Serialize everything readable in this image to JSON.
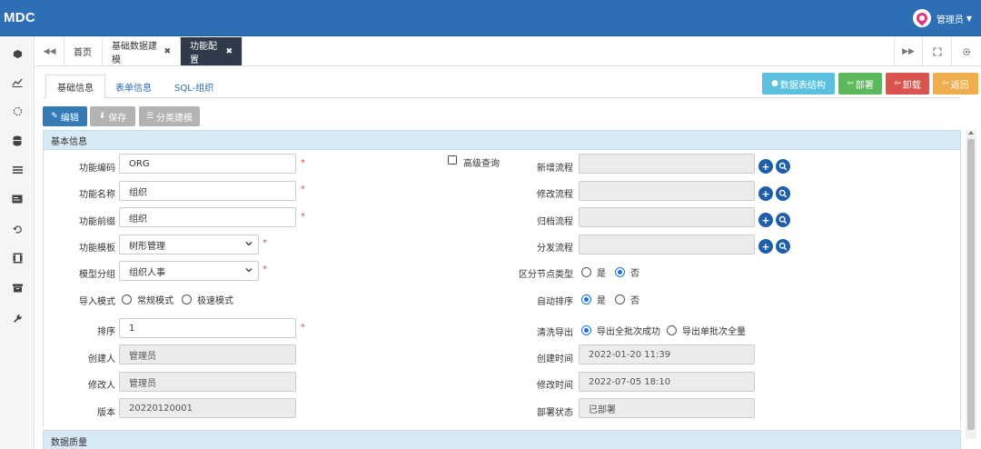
{
  "app": {
    "brand": "MDC",
    "user_name": "管理员"
  },
  "sidebar": {
    "icons": [
      "cube-icon",
      "chart-line-icon",
      "spinner-icon",
      "database-icon",
      "list-icon",
      "card-icon",
      "history-icon",
      "film-icon",
      "archive-icon",
      "wrench-icon"
    ]
  },
  "tabstrip": {
    "tabs": [
      {
        "label": "首页",
        "closable": false
      },
      {
        "label": "基础数据建模",
        "closable": true
      },
      {
        "label": "功能配置",
        "closable": true
      }
    ],
    "close_glyph": "✖"
  },
  "inner_tabs": [
    "基础信息",
    "表单信息",
    "SQL-组织"
  ],
  "right_buttons": {
    "structure": "数据表结构",
    "deploy": "部署",
    "undeploy": "卸载",
    "back": "返回",
    "colors": {
      "structure": "#5bc0de",
      "deploy": "#5cb85c",
      "undeploy": "#d9534f",
      "back": "#f0ad4e"
    }
  },
  "actions": {
    "edit": "编辑",
    "save": "保存",
    "category": "分类建模"
  },
  "panel": {
    "title": "基本信息",
    "next_title": "数据质量"
  },
  "form": {
    "func_code": {
      "label": "功能编码",
      "value": "ORG"
    },
    "func_name": {
      "label": "功能名称",
      "value": "组织"
    },
    "func_prefix": {
      "label": "功能前缀",
      "value": "组织"
    },
    "func_template": {
      "label": "功能模板",
      "value": "树形管理"
    },
    "model_group": {
      "label": "模型分组",
      "value": "组织人事"
    },
    "import_mode": {
      "label": "导入模式",
      "options": [
        "常规模式",
        "极速模式"
      ]
    },
    "sort": {
      "label": "排序",
      "value": "1"
    },
    "creator": {
      "label": "创建人",
      "value": "管理员"
    },
    "modifier": {
      "label": "修改人",
      "value": "管理员"
    },
    "version": {
      "label": "版本",
      "value": "20220120001"
    },
    "advanced_query": {
      "label": "高级查询"
    },
    "new_flow": {
      "label": "新增流程",
      "value": ""
    },
    "edit_flow": {
      "label": "修改流程",
      "value": ""
    },
    "archive_flow": {
      "label": "归档流程",
      "value": ""
    },
    "dispatch_flow": {
      "label": "分发流程",
      "value": ""
    },
    "node_type": {
      "label": "区分节点类型",
      "yes": "是",
      "no": "否",
      "selected": "no"
    },
    "auto_sort": {
      "label": "自动排序",
      "yes": "是",
      "no": "否",
      "selected": "yes"
    },
    "clean_export": {
      "label": "清洗导出",
      "opt1": "导出全批次成功",
      "opt2": "导出单批次全量",
      "selected": "opt1"
    },
    "created_time": {
      "label": "创建时间",
      "value": "2022-01-20 11:39"
    },
    "modified_time": {
      "label": "修改时间",
      "value": "2022-07-05 18:10"
    },
    "deploy_status": {
      "label": "部署状态",
      "value": "已部署"
    }
  },
  "required_mark": "*"
}
